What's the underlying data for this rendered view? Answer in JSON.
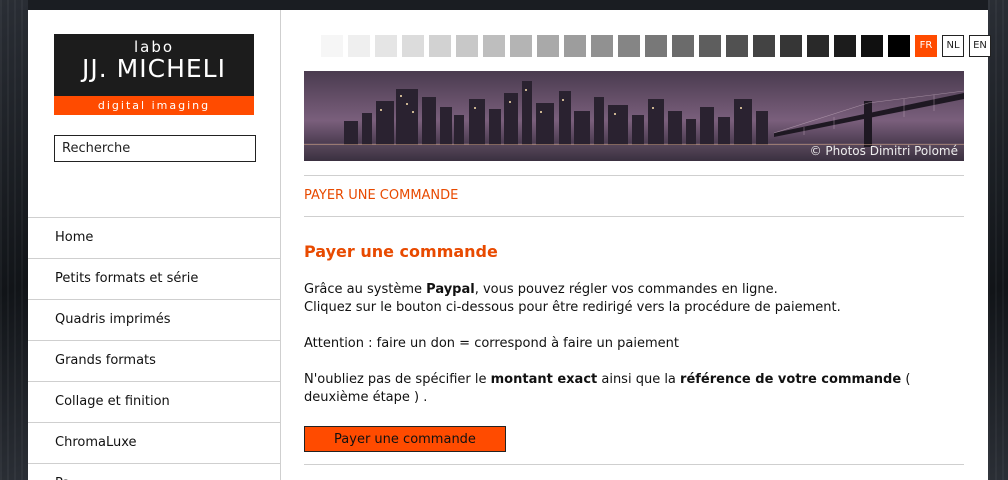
{
  "logo": {
    "line1": "labo",
    "line2": "JJ. MICHELI",
    "tagline": "digital imaging"
  },
  "search": {
    "placeholder": "Recherche"
  },
  "nav": {
    "items": [
      {
        "label": "Home"
      },
      {
        "label": "Petits formats et série"
      },
      {
        "label": "Quadris imprimés"
      },
      {
        "label": "Grands formats"
      },
      {
        "label": "Collage et finition"
      },
      {
        "label": "ChromaLuxe"
      },
      {
        "label": "Pa..."
      }
    ]
  },
  "swatches": [
    "#f6f6f6",
    "#efefef",
    "#e5e5e5",
    "#dcdcdc",
    "#d2d2d2",
    "#c8c8c8",
    "#bebebe",
    "#b4b4b4",
    "#a9a9a9",
    "#9d9d9d",
    "#919191",
    "#858585",
    "#787878",
    "#6b6b6b",
    "#5e5e5e",
    "#515151",
    "#434343",
    "#363636",
    "#292929",
    "#1c1c1c",
    "#101010",
    "#000000"
  ],
  "languages": [
    {
      "code": "FR",
      "active": true
    },
    {
      "code": "NL",
      "active": false
    },
    {
      "code": "EN",
      "active": false
    }
  ],
  "banner": {
    "credit": "© Photos Dimitri Polomé"
  },
  "breadcrumb": "PAYER UNE COMMANDE",
  "content": {
    "title": "Payer une commande",
    "p1_before": "Grâce au système ",
    "p1_bold": "Paypal",
    "p1_after": ", vous pouvez régler vos commandes en ligne.",
    "p1_line2": "Cliquez sur le bouton ci-dessous pour être redirigé vers la procédure de paiement.",
    "p2": "Attention : faire un don = correspond à faire un paiement",
    "p3_a": "N'oubliez pas de spécifier le ",
    "p3_b": "montant exact",
    "p3_c": " ainsi que la ",
    "p3_d": "référence de votre commande",
    "p3_e": " ( deuxième étape ) .",
    "button_label": "Payer une commande"
  },
  "colors": {
    "accent": "#ff4b00"
  }
}
